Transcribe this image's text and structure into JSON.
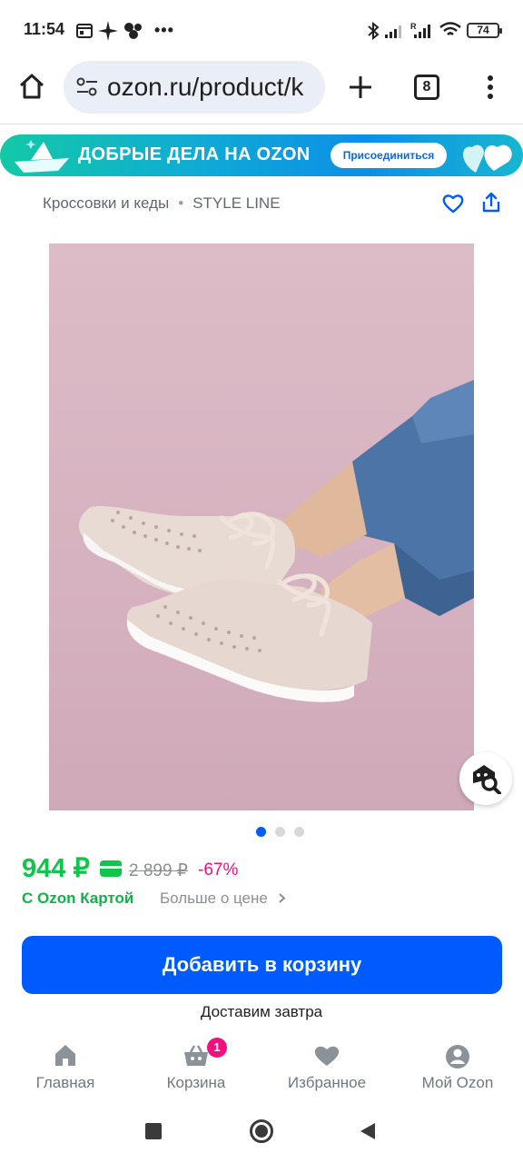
{
  "status_bar": {
    "time": "11:54",
    "battery": "74"
  },
  "browser": {
    "url": "ozon.ru/product/k",
    "tab_count": "8"
  },
  "banner": {
    "text": "ДОБРЫЕ ДЕЛА НА OZON",
    "button": "Присоединиться"
  },
  "breadcrumb": {
    "category": "Кроссовки и кеды",
    "brand": "STYLE LINE"
  },
  "gallery": {
    "current_index": 1,
    "count": 3
  },
  "price": {
    "current": "944 ₽",
    "old": "2 899 ₽",
    "discount": "-67%",
    "card_label": "С Ozon Картой",
    "more_label": "Больше о цене"
  },
  "actions": {
    "add_to_cart": "Добавить в корзину",
    "delivery": "Доставим завтра"
  },
  "bottom_nav": {
    "items": [
      {
        "label": "Главная",
        "icon": "home-icon"
      },
      {
        "label": "Корзина",
        "icon": "basket-icon",
        "badge": "1"
      },
      {
        "label": "Избранное",
        "icon": "heart-icon"
      },
      {
        "label": "Мой Ozon",
        "icon": "profile-icon"
      }
    ]
  },
  "colors": {
    "accent_blue": "#005bff",
    "price_green": "#10c44c",
    "discount_pink": "#f1117e"
  }
}
